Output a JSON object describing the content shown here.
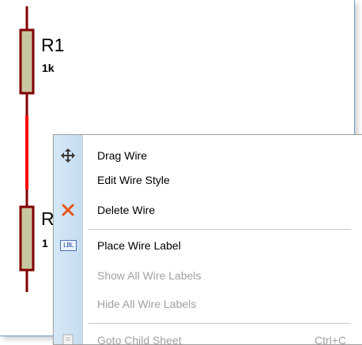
{
  "schematic": {
    "r1_ref": "R1",
    "r1_value": "1k",
    "r2_ref": "R",
    "r2_value": "1",
    "colors": {
      "wire_selected": "#ff0000",
      "wire_pin": "#800000",
      "resistor_fill": "#c8c8a0"
    }
  },
  "context_menu": {
    "items": [
      {
        "label": "Drag Wire",
        "icon": "move-arrows-icon",
        "enabled": true
      },
      {
        "label": "Edit Wire Style",
        "icon": "",
        "enabled": true
      },
      {
        "label": "Delete Wire",
        "icon": "delete-x-icon",
        "enabled": true
      },
      {
        "label": "Place Wire Label",
        "icon": "wire-label-icon",
        "icon_text": "LBL",
        "enabled": true
      },
      {
        "label": "Show All Wire Labels",
        "icon": "",
        "enabled": false
      },
      {
        "label": "Hide All Wire Labels",
        "icon": "",
        "enabled": false
      },
      {
        "label": "Goto Child Sheet",
        "icon": "child-sheet-icon",
        "shortcut": "Ctrl+C",
        "enabled": false
      }
    ]
  }
}
